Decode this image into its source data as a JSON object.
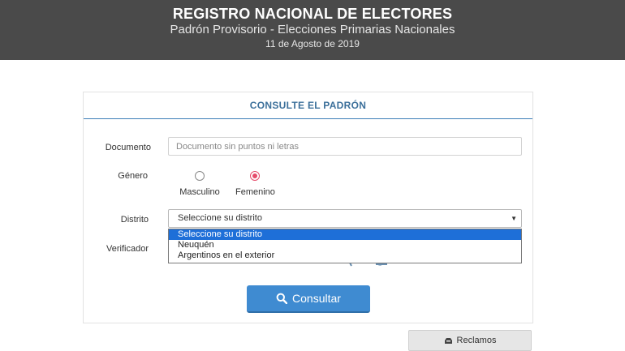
{
  "header": {
    "title": "REGISTRO NACIONAL DE ELECTORES",
    "subtitle": "Padrón Provisorio - Elecciones Primarias Nacionales",
    "date": "11 de Agosto de 2019"
  },
  "panel": {
    "heading": "CONSULTE EL PADRÓN"
  },
  "form": {
    "documento_label": "Documento",
    "documento_placeholder": "Documento sin puntos ni letras",
    "genero_label": "Género",
    "genero_options": [
      {
        "label": "Masculino",
        "checked": false
      },
      {
        "label": "Femenino",
        "checked": true
      }
    ],
    "distrito_label": "Distrito",
    "distrito_selected": "Seleccione su distrito",
    "distrito_options": [
      {
        "label": "Seleccione su distrito",
        "selected": true
      },
      {
        "label": "Neuquén",
        "selected": false
      },
      {
        "label": "Argentinos en el exterior",
        "selected": false
      }
    ],
    "verificador_label": "Verificador",
    "consultar_label": "Consultar"
  },
  "footer": {
    "reclamos_label": "Reclamos"
  },
  "colors": {
    "header_bg": "#4a4a4a",
    "accent": "#3f8bd1",
    "radio_checked": "#e64b6a",
    "option_selected": "#1e6fd8"
  }
}
